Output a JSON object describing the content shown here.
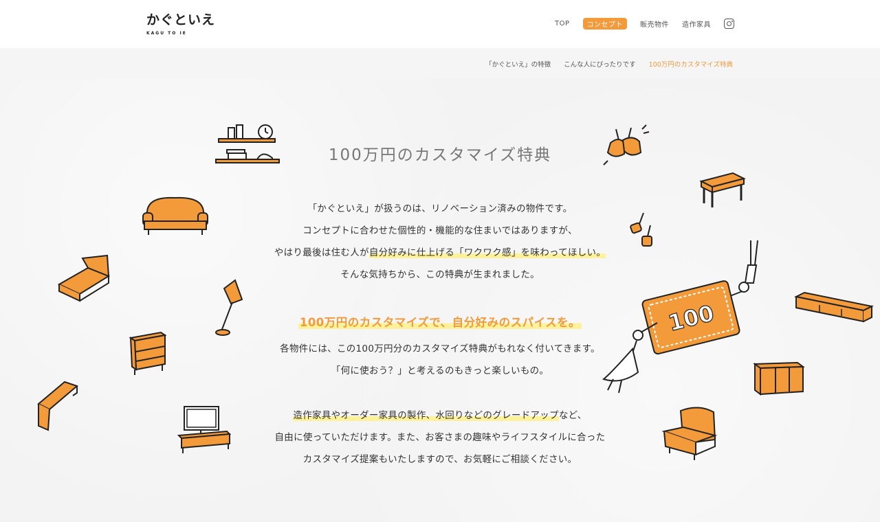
{
  "header": {
    "logo_main": "かぐといえ",
    "logo_sub": "KAGU TO IE",
    "nav": [
      {
        "label": "TOP"
      },
      {
        "label": "コンセプト"
      },
      {
        "label": "販売物件"
      },
      {
        "label": "造作家具"
      }
    ],
    "instagram_icon": "instagram-icon"
  },
  "subnav": {
    "items": [
      {
        "label": "「かぐといえ」の特徴"
      },
      {
        "label": "こんな人にぴったりです"
      },
      {
        "label": "100万円のカスタマイズ特典"
      }
    ]
  },
  "main": {
    "title": "100万円のカスタマイズ特典",
    "para1": {
      "line1": "「かぐといえ」が扱うのは、リノベーション済みの物件です。",
      "line2": "コンセプトに合わせた個性的・機能的な住まいではありますが、",
      "line3_pre": "やはり最後は住む人が",
      "line3_hl": "自分好みに仕上げる「ワクワク感」を味わってほしい。",
      "line4": "そんな気持ちから、この特典が生まれました。"
    },
    "subheading": "100万円のカスタマイズで、自分好みのスパイスを。",
    "para2": {
      "line1": "各物件には、この100万円分のカスタマイズ特典がもれなく付いてきます。",
      "line2": "「何に使おう？」と考えるのもきっと楽しいもの。"
    },
    "para3": {
      "line1_hl": "造作家具やオーダー家具の製作、水回りなどのグレードアップ",
      "line1_post": "など、",
      "line2": "自由に使っていただけます。また、お客さまの趣味やライフスタイルに合った",
      "line3": "カスタマイズ提案もいたしますので、お気軽にご相談ください。"
    },
    "money_label": "100"
  },
  "colors": {
    "accent": "#f39a3b",
    "highlight": "#fdf29b",
    "text": "#333333"
  }
}
